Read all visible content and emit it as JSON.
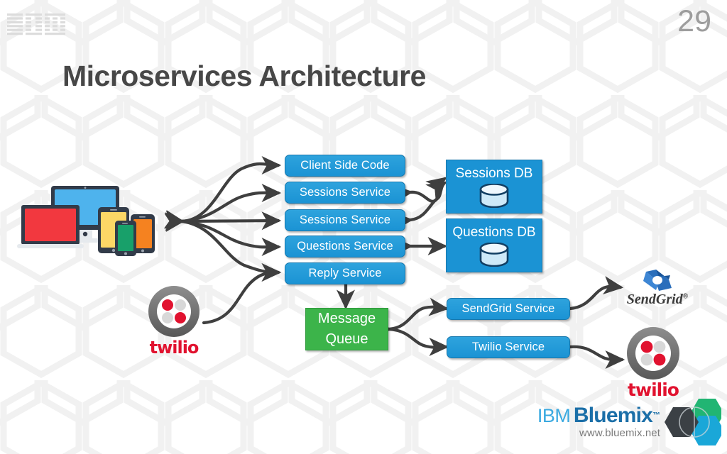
{
  "slide": {
    "page_number": "29",
    "title": "Microservices Architecture",
    "brand_logo": "ibm-logo",
    "title_color": "#474747",
    "page_number_color": "#9d9d9d",
    "background_color": "#ffffff"
  },
  "colors": {
    "service_blue": "#1b93d4",
    "service_blue_border": "#1878ad",
    "queue_green": "#3cb44a",
    "arrow_gray": "#3f3f3f",
    "twilio_red": "#e1122f",
    "sendgrid_blue": "#2a6ebb",
    "bluemix_light_blue": "#3aa9e0",
    "bluemix_dark_blue": "#1b6fa8"
  },
  "diagram": {
    "clients": {
      "name": "multi-device-cluster",
      "devices": [
        {
          "type": "desktop-monitor",
          "color": "#4eb3ed"
        },
        {
          "type": "laptop",
          "color": "#f2383f"
        },
        {
          "type": "tablet",
          "color": "#fcd766"
        },
        {
          "type": "smartphone",
          "color": "#18a06a"
        },
        {
          "type": "smartphone",
          "color": "#f58220"
        }
      ]
    },
    "services": [
      {
        "id": "client-side-code",
        "label": "Client Side Code",
        "kind": "service"
      },
      {
        "id": "sessions-service-1",
        "label": "Sessions Service",
        "kind": "service"
      },
      {
        "id": "sessions-service-2",
        "label": "Sessions Service",
        "kind": "service"
      },
      {
        "id": "questions-service",
        "label": "Questions Service",
        "kind": "service"
      },
      {
        "id": "reply-service",
        "label": "Reply Service",
        "kind": "service"
      }
    ],
    "databases": [
      {
        "id": "sessions-db",
        "label": "Sessions DB",
        "icon": "database-cylinder-icon"
      },
      {
        "id": "questions-db",
        "label": "Questions DB",
        "icon": "database-cylinder-icon"
      }
    ],
    "queue": {
      "id": "message-queue",
      "label_line1": "Message",
      "label_line2": "Queue"
    },
    "integration_services": [
      {
        "id": "sendgrid-service",
        "label": "SendGrid Service"
      },
      {
        "id": "twilio-service",
        "label": "Twilio Service"
      }
    ],
    "external_providers": [
      {
        "id": "twilio-left",
        "label": "twilio",
        "icon": "twilio-logo"
      },
      {
        "id": "sendgrid",
        "label": "SendGrid",
        "icon": "sendgrid-logo"
      },
      {
        "id": "twilio-right",
        "label": "twilio",
        "icon": "twilio-logo"
      }
    ],
    "connections": [
      {
        "from": "multi-device-cluster",
        "to": "client-side-code",
        "style": "bidirectional-curved"
      },
      {
        "from": "multi-device-cluster",
        "to": "sessions-service-1",
        "style": "bidirectional-curved"
      },
      {
        "from": "multi-device-cluster",
        "to": "sessions-service-2",
        "style": "bidirectional-straight"
      },
      {
        "from": "multi-device-cluster",
        "to": "questions-service",
        "style": "bidirectional-curved"
      },
      {
        "from": "multi-device-cluster",
        "to": "reply-service",
        "style": "bidirectional-curved"
      },
      {
        "from": "sessions-service-1",
        "to": "sessions-db",
        "style": "bidirectional-curved"
      },
      {
        "from": "sessions-service-2",
        "to": "sessions-db",
        "style": "bidirectional-curved"
      },
      {
        "from": "questions-service",
        "to": "questions-db",
        "style": "bidirectional-straight"
      },
      {
        "from": "reply-service",
        "to": "message-queue",
        "style": "bidirectional-straight"
      },
      {
        "from": "message-queue",
        "to": "sendgrid-service",
        "style": "bidirectional-curved"
      },
      {
        "from": "message-queue",
        "to": "twilio-service",
        "style": "bidirectional-curved"
      },
      {
        "from": "sendgrid-service",
        "to": "sendgrid",
        "style": "bidirectional-curved"
      },
      {
        "from": "twilio-service",
        "to": "twilio-right",
        "style": "bidirectional-curved"
      },
      {
        "from": "twilio-left",
        "to": "reply-service",
        "style": "curved"
      }
    ]
  },
  "footer": {
    "brand_ibm": "IBM",
    "brand_product": "Bluemix",
    "trademark": "™",
    "url": "www.bluemix.net",
    "logo": "bluemix-hexagon-logo"
  }
}
